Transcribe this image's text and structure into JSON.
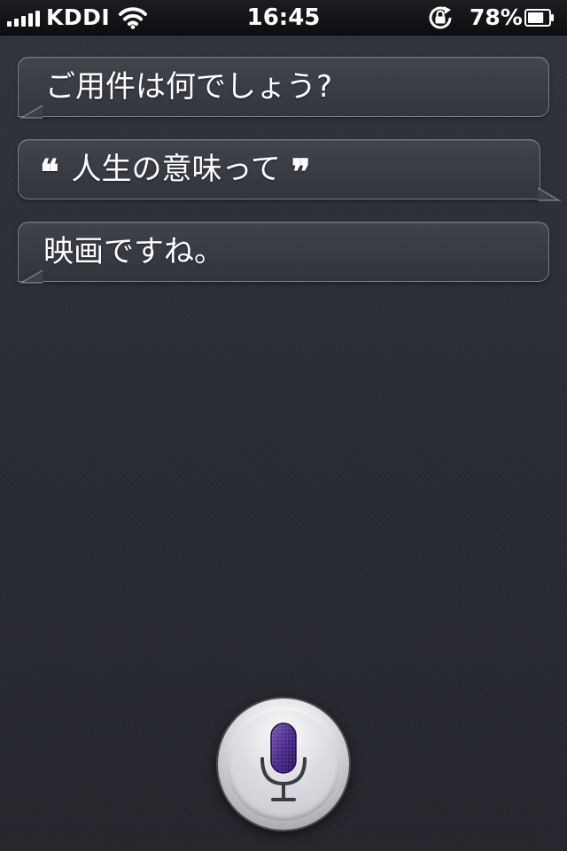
{
  "status_bar": {
    "carrier": "KDDI",
    "time": "16:45",
    "battery_percent": "78%",
    "battery_level": 0.78,
    "signal_bars": 5,
    "icons": [
      "signal-bars-icon",
      "wifi-icon",
      "rotation-lock-icon",
      "battery-icon"
    ]
  },
  "conversation": {
    "siri_prompt": "ご用件は何でしょう?",
    "user_query": "人生の意味って",
    "quote_open": "❝",
    "quote_close": "❞",
    "siri_response": "映画ですね。"
  },
  "mic_button": {
    "icon": "microphone-icon",
    "accent_color": "#4b2a8c"
  },
  "colors": {
    "background": "#2b2d34",
    "status_bar": "#0d0e10",
    "bubble_border": "#c9ccd4",
    "text": "#ffffff"
  }
}
